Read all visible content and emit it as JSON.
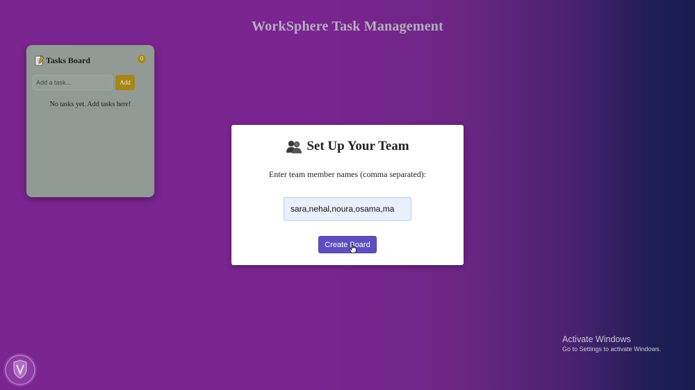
{
  "app": {
    "title": "WorkSphere Task Management"
  },
  "board": {
    "title": "Tasks Board",
    "count": "0",
    "input_placeholder": "Add a task...",
    "add_label": "Add",
    "empty_message": "No tasks yet. Add tasks here!",
    "icon": "memo-icon"
  },
  "setup_modal": {
    "icon": "team-icon",
    "title": "Set Up Your Team",
    "label": "Enter team member names (comma separated):",
    "input_value": "sara,nehal,noura,osama,ma",
    "button_label": "Create Board"
  },
  "windows_activation": {
    "title": "Activate Windows",
    "subtitle": "Go to Settings to activate Windows."
  },
  "colors": {
    "background_start": "#7b2590",
    "background_end": "#171c4f",
    "accent_gold": "#a78518",
    "button_purple": "#5e4fc1",
    "modal_bg": "#ffffff"
  }
}
